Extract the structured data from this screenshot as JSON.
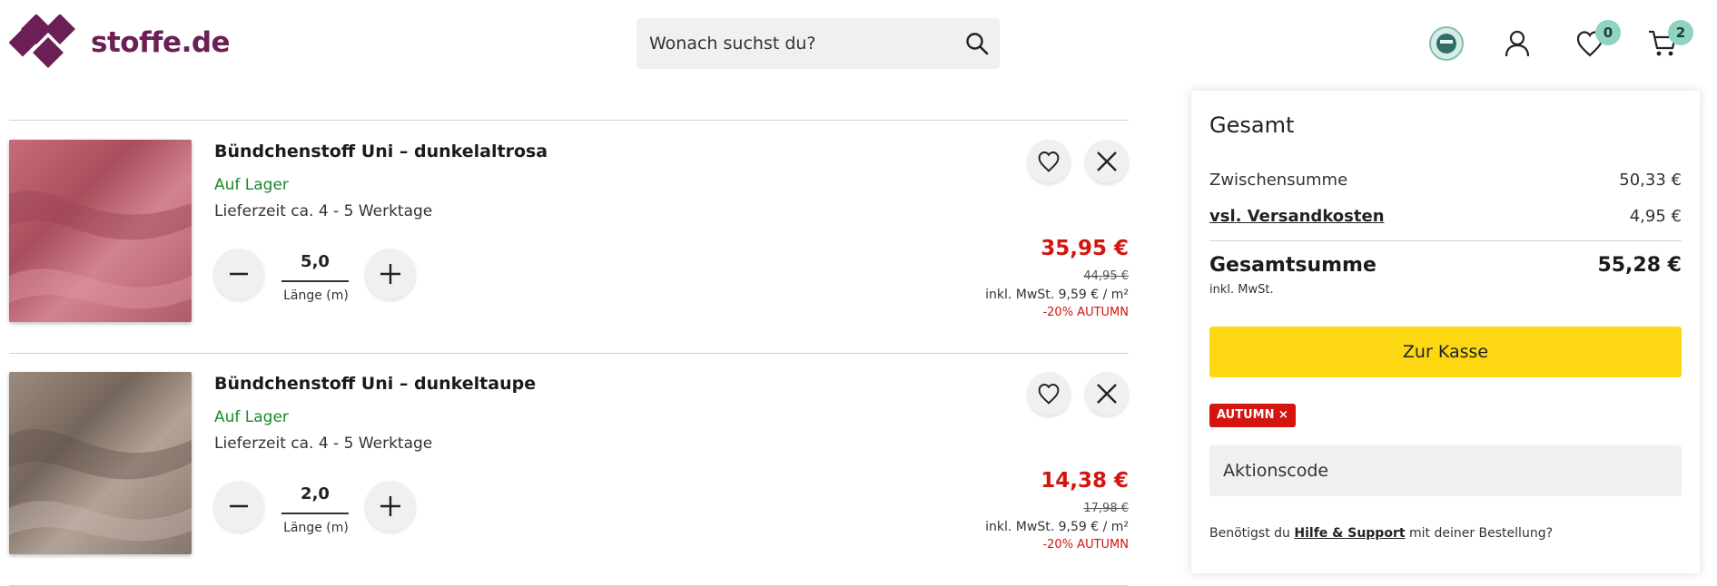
{
  "brand": {
    "name": "stoffe.de",
    "color": "#6b1f55"
  },
  "search": {
    "placeholder": "Wonach suchst du?"
  },
  "header": {
    "wishlist_count": "0",
    "cart_count": "2",
    "badge_color": "#8fd3c3"
  },
  "cart": {
    "items": [
      {
        "title": "Bündchenstoff Uni – dunkelaltrosa",
        "stock": "Auf Lager",
        "delivery": "Lieferzeit ca. 4 - 5 Werktage",
        "quantity": "5,0",
        "quantity_label": "Länge (m)",
        "price": "35,95 €",
        "old_price": "44,95 €",
        "unit_price": "inkl. MwSt. 9,59 € / m²",
        "promo": "-20% AUTUMN",
        "swatch_color": "#b8606c"
      },
      {
        "title": "Bündchenstoff Uni – dunkeltaupe",
        "stock": "Auf Lager",
        "delivery": "Lieferzeit ca. 4 - 5 Werktage",
        "quantity": "2,0",
        "quantity_label": "Länge (m)",
        "price": "14,38 €",
        "old_price": "17,98 €",
        "unit_price": "inkl. MwSt. 9,59 € / m²",
        "promo": "-20% AUTUMN",
        "swatch_color": "#8c7b6e"
      }
    ]
  },
  "summary": {
    "title": "Gesamt",
    "subtotal_label": "Zwischensumme",
    "subtotal_value": "50,33 €",
    "shipping_label": "vsl. Versandkosten",
    "shipping_value": "4,95 €",
    "total_label": "Gesamtsumme",
    "total_value": "55,28 €",
    "vat_note": "inkl. MwSt.",
    "checkout_label": "Zur Kasse",
    "checkout_color": "#fdd712",
    "applied_code": "AUTUMN ×",
    "promo_placeholder": "Aktionscode",
    "help_prefix": "Benötigst du",
    "help_link": "Hilfe & Support",
    "help_suffix": "mit deiner Bestellung?"
  },
  "colors": {
    "sale_red": "#d4140f",
    "stock_green": "#1a8a2c"
  }
}
